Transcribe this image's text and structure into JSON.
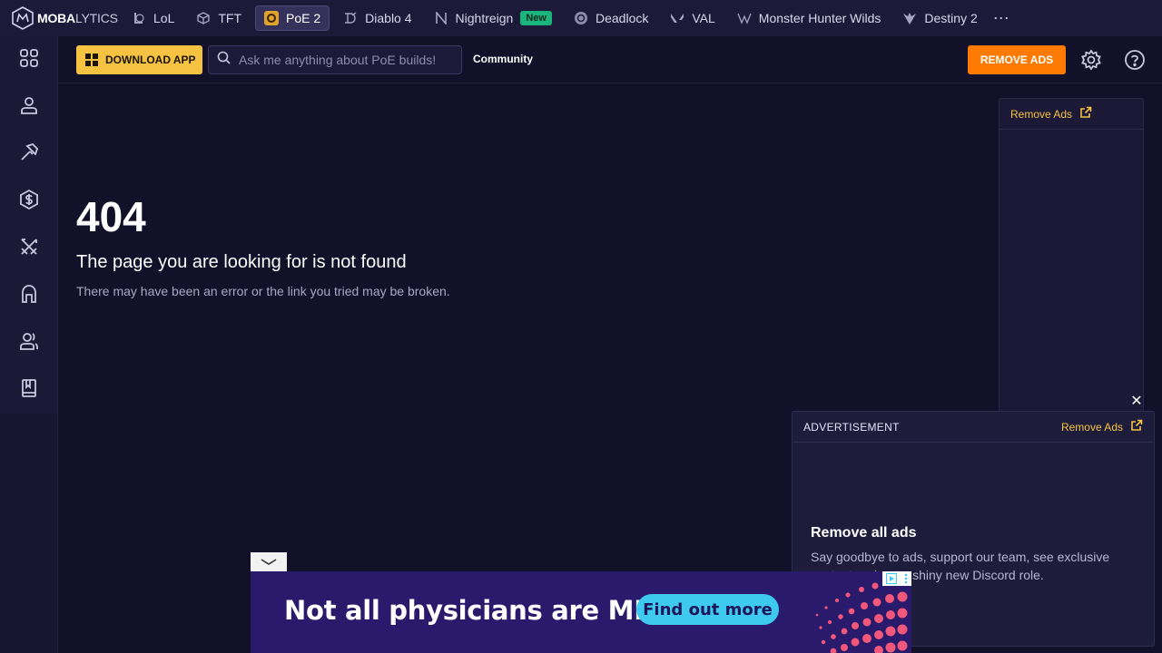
{
  "brand": {
    "bold": "MOBA",
    "light": "LYTICS"
  },
  "games": [
    {
      "label": "LoL",
      "icon": "lol-icon",
      "active": false
    },
    {
      "label": "TFT",
      "icon": "tft-icon",
      "active": false
    },
    {
      "label": "PoE 2",
      "icon": "poe2-icon",
      "active": true
    },
    {
      "label": "Diablo 4",
      "icon": "diablo-icon",
      "active": false
    },
    {
      "label": "Nightreign",
      "icon": "nightreign-icon",
      "active": false,
      "badge": "New"
    },
    {
      "label": "Deadlock",
      "icon": "deadlock-icon",
      "active": false
    },
    {
      "label": "VAL",
      "icon": "valorant-icon",
      "active": false
    },
    {
      "label": "Monster Hunter Wilds",
      "icon": "monster-hunter-icon",
      "active": false
    },
    {
      "label": "Destiny 2",
      "icon": "destiny-icon",
      "active": false
    }
  ],
  "more_label": "⋯",
  "sidebar": {
    "items": [
      "apps-grid-icon",
      "profile-icon",
      "builds-hammer-icon",
      "currency-icon",
      "weapons-icon",
      "helmet-icon",
      "community-icon",
      "guide-book-icon"
    ]
  },
  "header": {
    "download_label": "DOWNLOAD APP",
    "search_placeholder": "Ask me anything about PoE builds!",
    "community_label": "Community",
    "remove_ads_label": "REMOVE ADS"
  },
  "error": {
    "code": "404",
    "title": "The page you are looking for is not found",
    "description": "There may have been an error or the link you tried may be broken."
  },
  "ad_column": {
    "remove_ads_label": "Remove Ads"
  },
  "ad_popup": {
    "label": "ADVERTISEMENT",
    "remove_ads_label": "Remove Ads",
    "heading": "Remove all ads",
    "body": "Say goodbye to ads, support our team, see exclusive content and get a shiny new Discord role."
  },
  "banner": {
    "headline": "Not all physicians are MDs.",
    "cta": "Find out more"
  },
  "colors": {
    "background": "#13112a",
    "accent_yellow": "#f5c242",
    "accent_orange": "#ff7a00",
    "new_badge": "#19b57a"
  }
}
